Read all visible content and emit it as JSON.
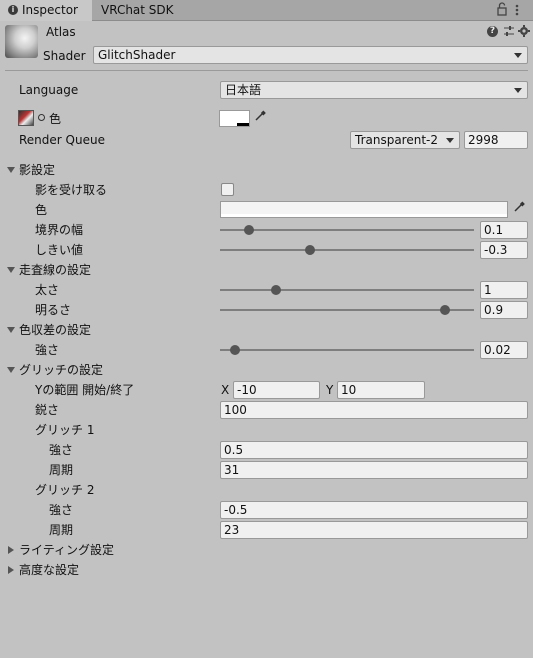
{
  "tabs": [
    {
      "label": "Inspector",
      "icon": "info-icon"
    },
    {
      "label": "VRChat SDK"
    }
  ],
  "header": {
    "name": "Atlas",
    "shader_label": "Shader",
    "shader_value": "GlitchShader"
  },
  "language": {
    "label": "Language",
    "value": "日本語"
  },
  "color": {
    "label": "色"
  },
  "render_queue": {
    "label": "Render Queue",
    "mode": "Transparent-2",
    "value": "2998"
  },
  "shadow": {
    "title": "影設定",
    "receive_label": "影を受け取る",
    "color_label": "色",
    "border_label": "境界の幅",
    "border_value": "0.1",
    "border_fraction": 0.1,
    "threshold_label": "しきい値",
    "threshold_value": "-0.3",
    "threshold_fraction": 0.35
  },
  "scanline": {
    "title": "走査線の設定",
    "thickness_label": "太さ",
    "thickness_value": "1",
    "thickness_fraction": 0.21,
    "brightness_label": "明るさ",
    "brightness_value": "0.9",
    "brightness_fraction": 0.9
  },
  "aberration": {
    "title": "色収差の設定",
    "strength_label": "強さ",
    "strength_value": "0.02",
    "strength_fraction": 0.04
  },
  "glitch": {
    "title": "グリッチの設定",
    "yrange_label": "Yの範囲 開始/終了",
    "x_label": "X",
    "x_value": "-10",
    "y_label": "Y",
    "y_value": "10",
    "sharpness_label": "鋭さ",
    "sharpness_value": "100",
    "g1_title": "グリッチ 1",
    "g1_strength_label": "強さ",
    "g1_strength_value": "0.5",
    "g1_period_label": "周期",
    "g1_period_value": "31",
    "g2_title": "グリッチ 2",
    "g2_strength_label": "強さ",
    "g2_strength_value": "-0.5",
    "g2_period_label": "周期",
    "g2_period_value": "23"
  },
  "lighting": {
    "title": "ライティング設定"
  },
  "advanced": {
    "title": "高度な設定"
  }
}
